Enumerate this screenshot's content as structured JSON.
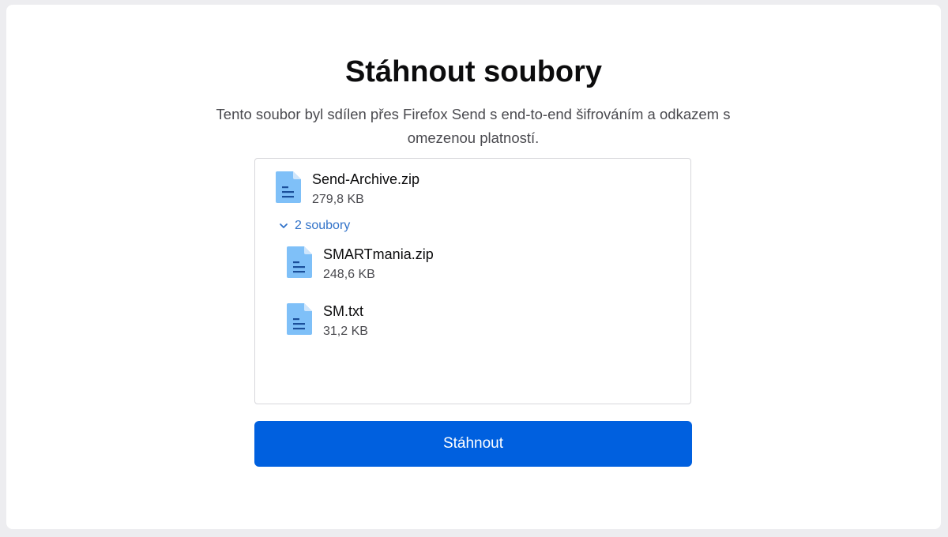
{
  "page": {
    "title": "Stáhnout soubory",
    "description": "Tento soubor byl sdílen přes Firefox Send s end-to-end šifrováním a odkazem s omezenou platností."
  },
  "archive": {
    "name": "Send-Archive.zip",
    "size": "279,8 KB",
    "icon": "file-icon"
  },
  "toggle": {
    "label": "2 soubory",
    "icon": "chevron-down-icon"
  },
  "files": [
    {
      "name": "SMARTmania.zip",
      "size": "248,6 KB",
      "icon": "file-icon"
    },
    {
      "name": "SM.txt",
      "size": "31,2 KB",
      "icon": "file-icon"
    }
  ],
  "actions": {
    "download_label": "Stáhnout"
  },
  "colors": {
    "accent": "#0060df",
    "icon": "#7fc0f8",
    "link": "#3273c9"
  }
}
